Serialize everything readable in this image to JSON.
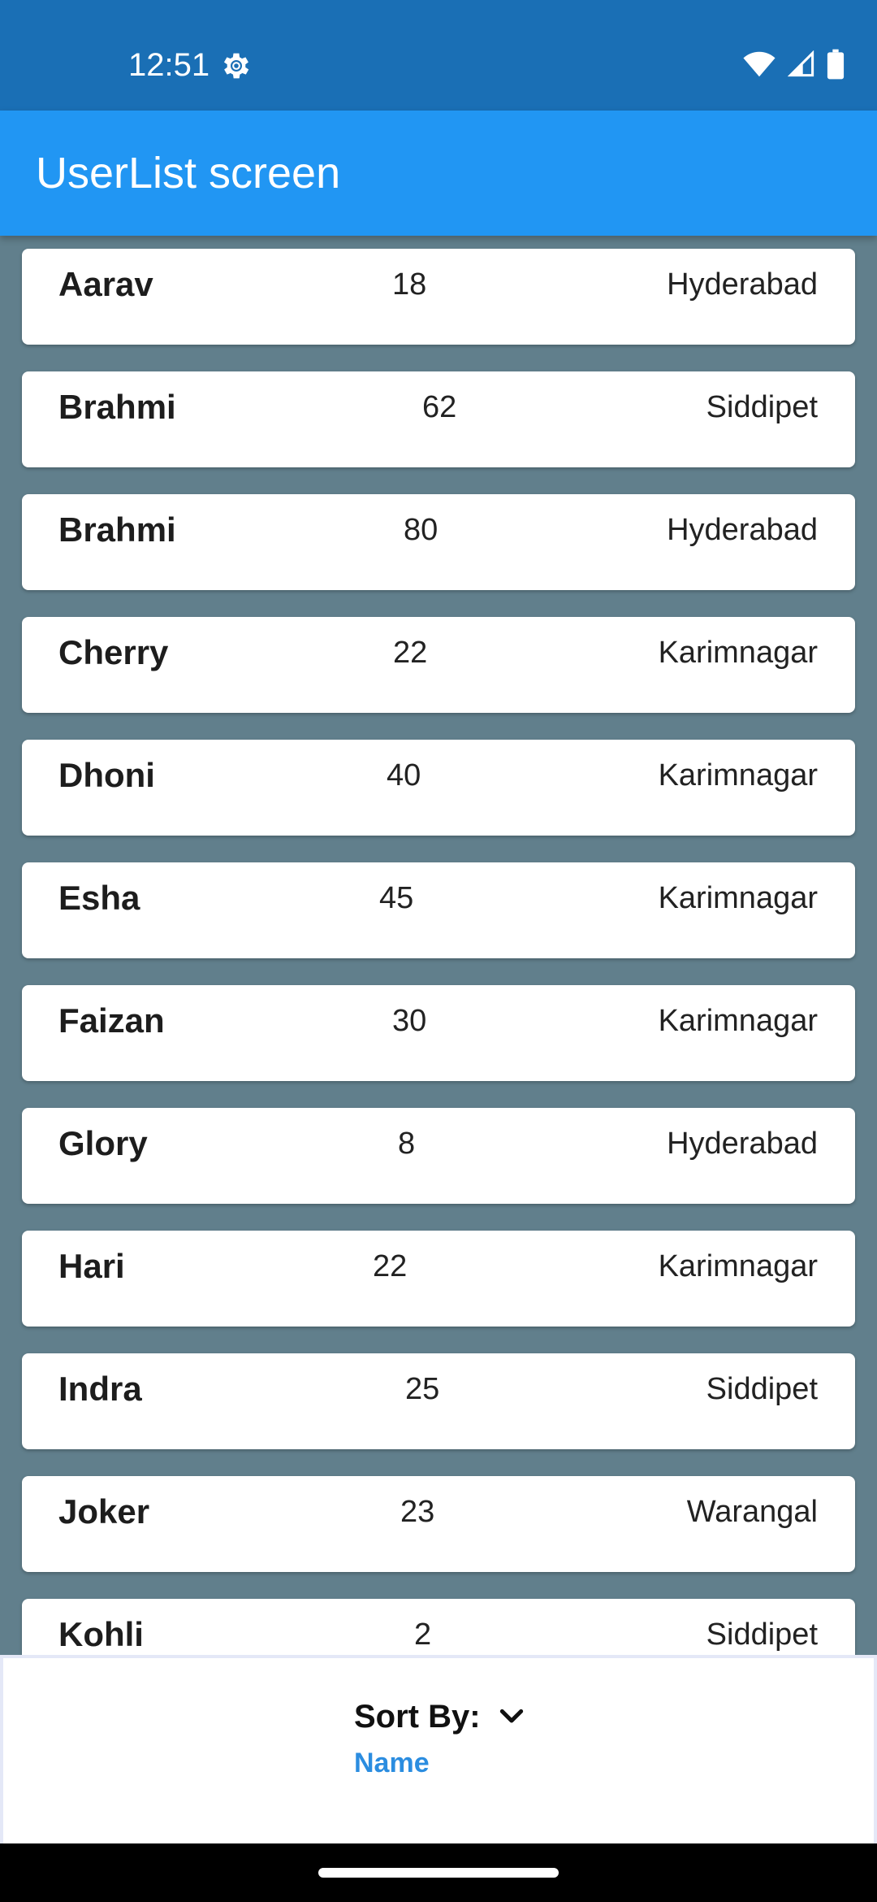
{
  "status_bar": {
    "time": "12:51",
    "icons": [
      "settings-gear-icon",
      "wifi-icon",
      "signal-icon",
      "battery-icon"
    ]
  },
  "app_bar": {
    "title": "UserList screen"
  },
  "users": [
    {
      "name": "Aarav",
      "age": "18",
      "city": "Hyderabad"
    },
    {
      "name": "Brahmi",
      "age": "62",
      "city": "Siddipet"
    },
    {
      "name": "Brahmi",
      "age": "80",
      "city": "Hyderabad"
    },
    {
      "name": "Cherry",
      "age": "22",
      "city": "Karimnagar"
    },
    {
      "name": "Dhoni",
      "age": "40",
      "city": "Karimnagar"
    },
    {
      "name": "Esha",
      "age": "45",
      "city": "Karimnagar"
    },
    {
      "name": "Faizan",
      "age": "30",
      "city": "Karimnagar"
    },
    {
      "name": "Glory",
      "age": "8",
      "city": "Hyderabad"
    },
    {
      "name": "Hari",
      "age": "22",
      "city": "Karimnagar"
    },
    {
      "name": "Indra",
      "age": "25",
      "city": "Siddipet"
    },
    {
      "name": "Joker",
      "age": "23",
      "city": "Warangal"
    },
    {
      "name": "Kohli",
      "age": "2",
      "city": "Siddipet"
    }
  ],
  "sort": {
    "label": "Sort By:",
    "value": "Name"
  },
  "colors": {
    "status_bar": "#1a6fb5",
    "app_bar": "#2196f3",
    "list_background": "#617f8c",
    "sort_value": "#2b8de0"
  }
}
